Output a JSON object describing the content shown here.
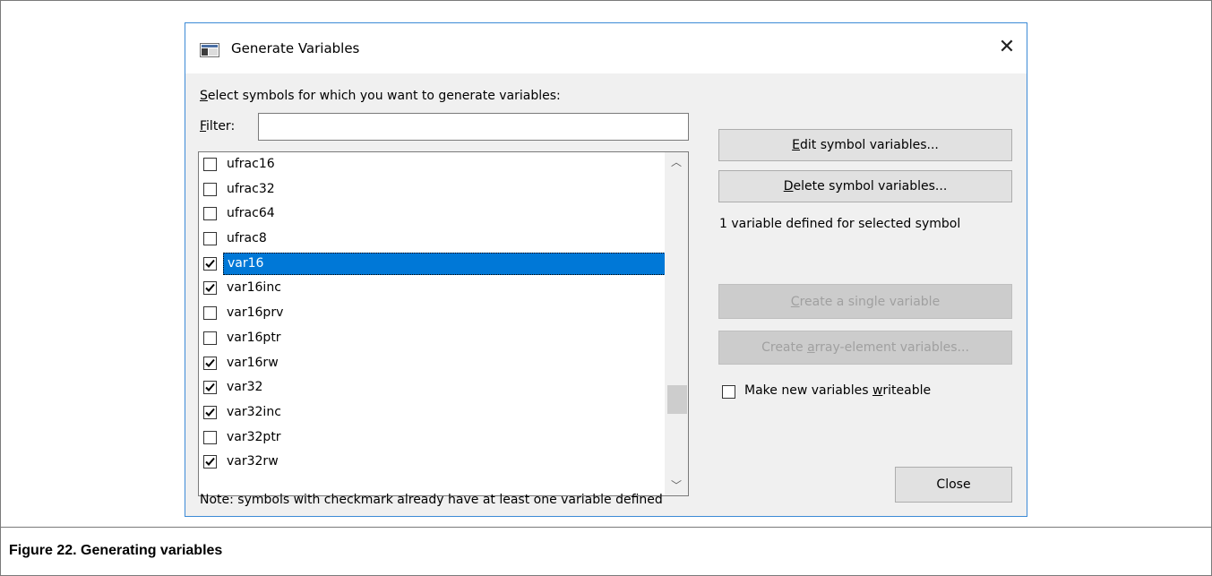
{
  "dialog": {
    "title": "Generate Variables",
    "close_glyph": "✕",
    "instruction": "Select symbols for which you want to generate variables:",
    "filter_label": "Filter:",
    "filter_value": "",
    "symbols": [
      {
        "name": "ufrac16",
        "checked": false,
        "selected": false
      },
      {
        "name": "ufrac32",
        "checked": false,
        "selected": false
      },
      {
        "name": "ufrac64",
        "checked": false,
        "selected": false
      },
      {
        "name": "ufrac8",
        "checked": false,
        "selected": false
      },
      {
        "name": "var16",
        "checked": true,
        "selected": true
      },
      {
        "name": "var16inc",
        "checked": true,
        "selected": false
      },
      {
        "name": "var16prv",
        "checked": false,
        "selected": false
      },
      {
        "name": "var16ptr",
        "checked": false,
        "selected": false
      },
      {
        "name": "var16rw",
        "checked": true,
        "selected": false
      },
      {
        "name": "var32",
        "checked": true,
        "selected": false
      },
      {
        "name": "var32inc",
        "checked": true,
        "selected": false
      },
      {
        "name": "var32ptr",
        "checked": false,
        "selected": false
      },
      {
        "name": "var32rw",
        "checked": true,
        "selected": false
      }
    ],
    "buttons": {
      "edit": "Edit symbol variables...",
      "delete": "Delete symbol variables...",
      "single": "Create a single variable",
      "array": "Create array-element variables...",
      "close": "Close"
    },
    "info": "1 variable defined for selected symbol",
    "writeable_label": "Make new variables writeable",
    "writeable_checked": false,
    "note": "Note: symbols with checkmark already have at least one variable defined"
  },
  "caption": "Figure 22.  Generating variables"
}
